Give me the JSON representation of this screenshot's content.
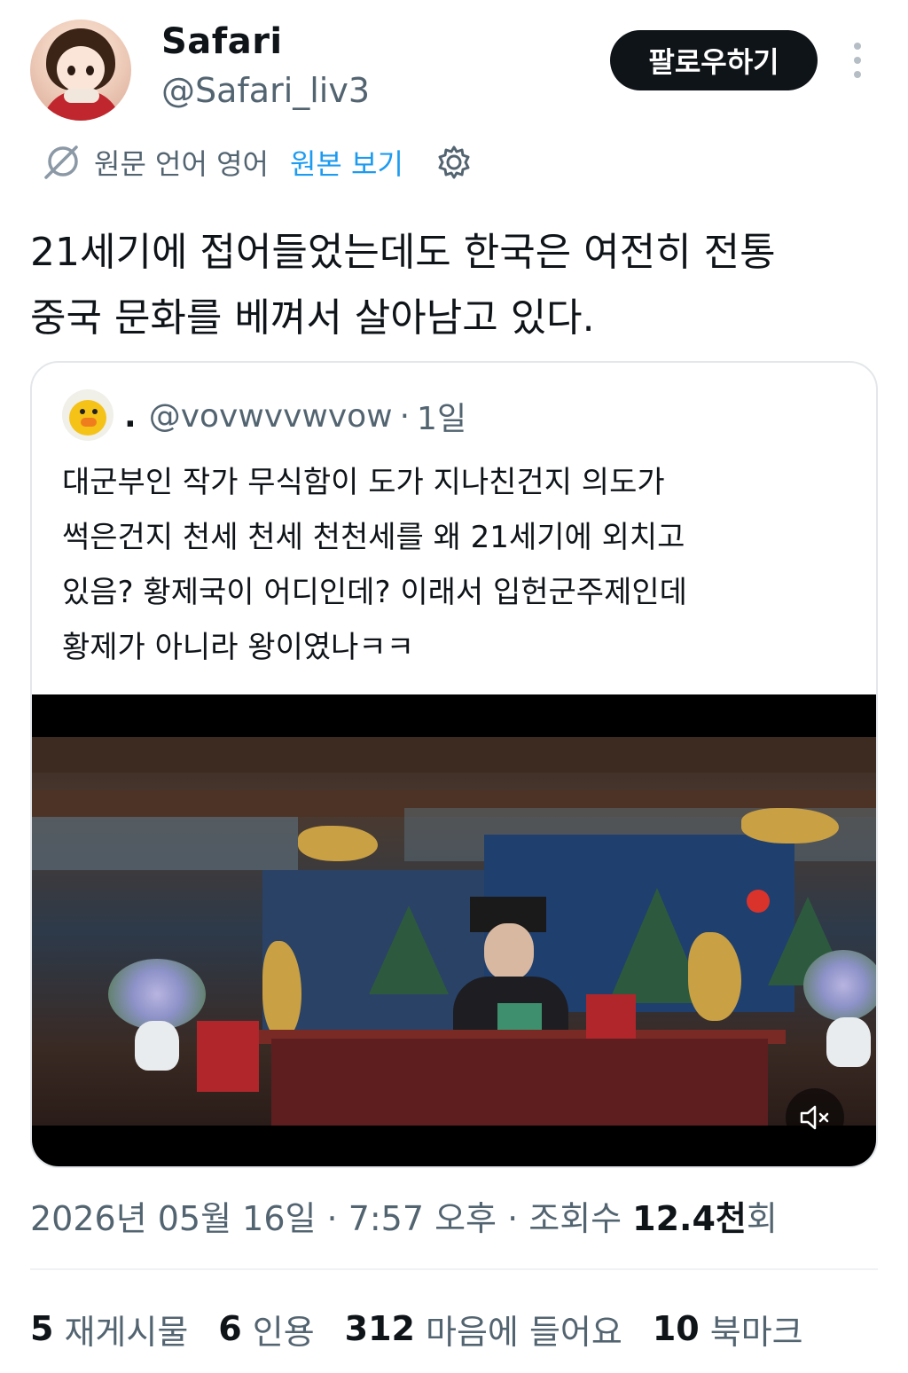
{
  "author": {
    "name": "Safari",
    "handle": "@Safari_liv3",
    "follow_label": "팔로우하기"
  },
  "translation": {
    "original_language": "원문 언어 영어",
    "view_original": "원본 보기"
  },
  "tweet": {
    "text_line1": "21세기에 접어들었는데도 한국은 여전히 전통",
    "text_line2": "중국 문화를 베껴서 살아남고 있다."
  },
  "quote": {
    "dot": ".",
    "handle": "@vovwvvwvow",
    "separator": "·",
    "time": "1일",
    "text_line1": "대군부인 작가 무식함이 도가 지나친건지 의도가",
    "text_line2": "썩은건지 천세 천세 천천세를 왜 21세기에 외치고",
    "text_line3": "있음? 황제국이 어디인데? 이래서 입헌군주제인데",
    "text_line4": "황제가 아니라 왕이였나ㅋㅋ"
  },
  "meta": {
    "date_time": "2026년 05월 16일 · 7:57 오후 · 조회수",
    "views_value": "12.4천",
    "views_suffix": "회"
  },
  "stats": {
    "reposts_num": "5",
    "reposts_label": "재게시물",
    "quotes_num": "6",
    "quotes_label": "인용",
    "likes_num": "312",
    "likes_label": "마음에 들어요",
    "bookmarks_num": "10",
    "bookmarks_label": "북마크"
  },
  "icons": {
    "more": "more-vertical-icon",
    "translate": "translate-icon",
    "settings": "gear-icon",
    "mute": "mute-icon"
  },
  "colors": {
    "accent": "#1d9bf0",
    "text": "#0f1419",
    "secondary": "#536471"
  }
}
